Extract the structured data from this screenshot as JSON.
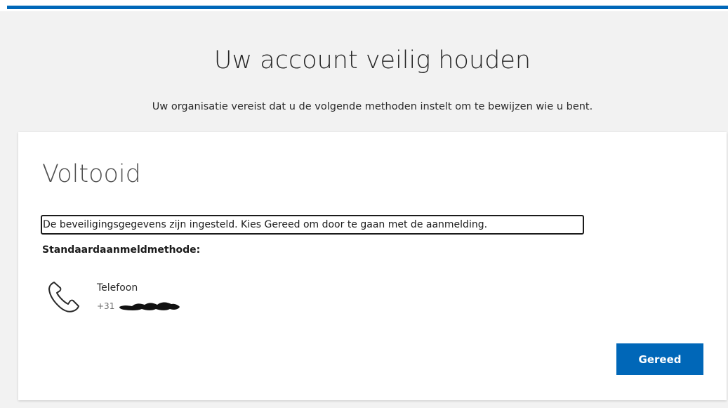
{
  "page": {
    "title": "Uw account veilig houden",
    "subtitle": "Uw organisatie vereist dat u de volgende methoden instelt om te bewijzen wie u bent."
  },
  "card": {
    "title": "Voltooid",
    "info_text": "De beveiligingsgegevens zijn ingesteld. Kies Gereed om door te gaan met de aanmelding.",
    "default_method_label": "Standaardaanmeldmethode:",
    "method": {
      "icon": "phone-icon",
      "name": "Telefoon",
      "number_visible": "+31"
    },
    "done_button_label": "Gereed"
  },
  "colors": {
    "accent": "#0067b8",
    "background": "#f2f2f2",
    "card": "#ffffff"
  }
}
